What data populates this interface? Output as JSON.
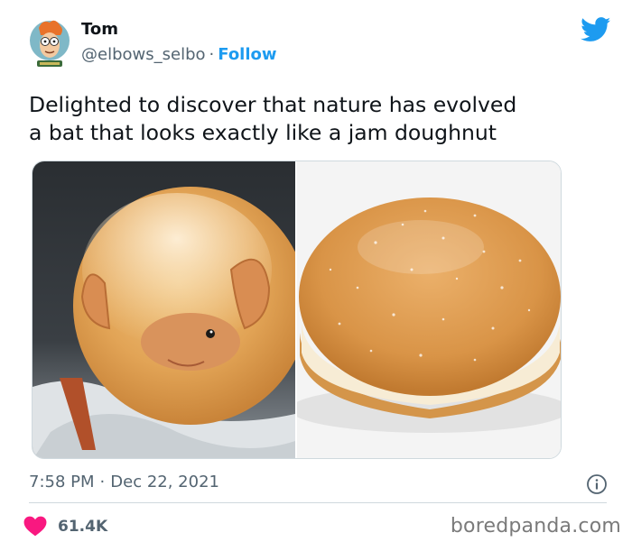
{
  "author": {
    "name": "Tom",
    "handle": "@elbows_selbo",
    "separator": "·",
    "follow_label": "Follow"
  },
  "tweet": {
    "text_line1": "Delighted to discover that nature has evolved",
    "text_line2": "a bat that looks exactly like a jam doughnut"
  },
  "meta": {
    "time": "7:58 PM",
    "separator": "·",
    "date": "Dec 22, 2021"
  },
  "engagement": {
    "likes": "61.4K"
  },
  "watermark": "boredpanda.com",
  "icons": {
    "brand": "twitter-bird-icon",
    "info": "info-icon",
    "like": "heart-icon"
  },
  "colors": {
    "twitter_blue": "#1d9bf0",
    "like_pink": "#f91880",
    "text_primary": "#0f1419",
    "text_secondary": "#536471",
    "divider": "#cfd9de"
  }
}
